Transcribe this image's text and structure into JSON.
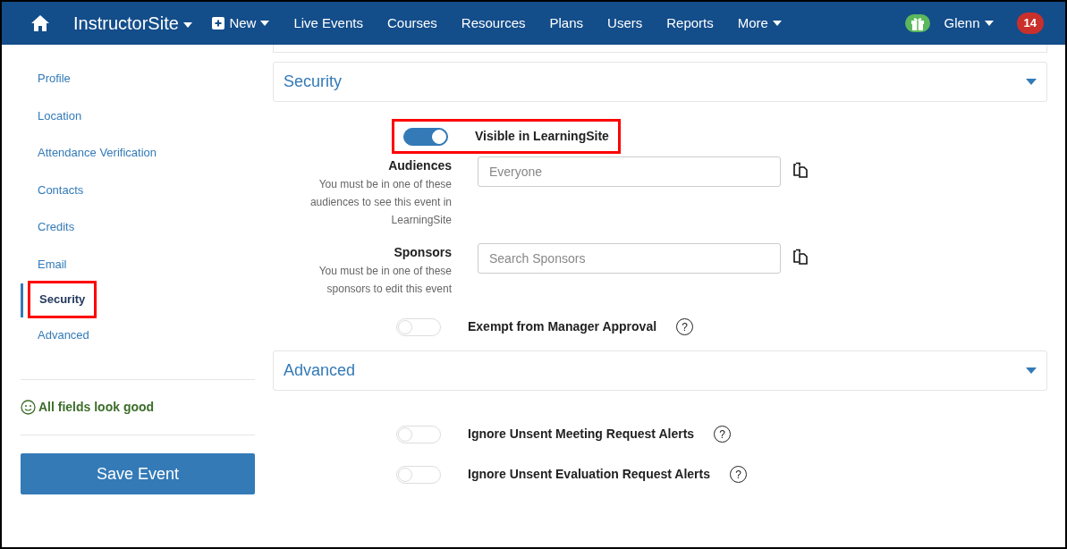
{
  "navbar": {
    "brand": "InstructorSite",
    "items": [
      {
        "label": "New",
        "kind": "new",
        "dropdown": true
      },
      {
        "label": "Live Events",
        "kind": "link",
        "dropdown": false
      },
      {
        "label": "Courses",
        "kind": "link",
        "dropdown": false
      },
      {
        "label": "Resources",
        "kind": "link",
        "dropdown": false
      },
      {
        "label": "Plans",
        "kind": "link",
        "dropdown": false
      },
      {
        "label": "Users",
        "kind": "link",
        "dropdown": false
      },
      {
        "label": "Reports",
        "kind": "link",
        "dropdown": false
      },
      {
        "label": "More",
        "kind": "link",
        "dropdown": true
      }
    ],
    "user": "Glenn",
    "notifications": "14"
  },
  "sidebar": {
    "items": [
      {
        "label": "Profile",
        "selected": false,
        "highlighted": false
      },
      {
        "label": "Location",
        "selected": false,
        "highlighted": false
      },
      {
        "label": "Attendance Verification",
        "selected": false,
        "highlighted": false
      },
      {
        "label": "Contacts",
        "selected": false,
        "highlighted": false
      },
      {
        "label": "Credits",
        "selected": false,
        "highlighted": false
      },
      {
        "label": "Email",
        "selected": false,
        "highlighted": false
      },
      {
        "label": "Security",
        "selected": true,
        "highlighted": true
      },
      {
        "label": "Advanced",
        "selected": false,
        "highlighted": false
      }
    ],
    "status": "All fields look good",
    "save_button": "Save Event"
  },
  "sections": [
    {
      "title": "Security",
      "rows": [
        {
          "kind": "toggle",
          "label": "Visible in LearningSite",
          "on": true,
          "highlighted": true
        },
        {
          "kind": "field",
          "label": "Audiences",
          "hint": "You must be in one of these audiences to see this event in LearningSite",
          "placeholder": "Everyone"
        },
        {
          "kind": "field",
          "label": "Sponsors",
          "hint": "You must be in one of these sponsors to edit this event",
          "placeholder": "Search Sponsors"
        },
        {
          "kind": "toggle",
          "label": "Exempt from Manager Approval",
          "on": false,
          "highlighted": false,
          "help": "?"
        }
      ]
    },
    {
      "title": "Advanced",
      "rows": [
        {
          "kind": "toggle",
          "label": "Ignore Unsent Meeting Request Alerts",
          "on": false,
          "highlighted": false,
          "help": "?"
        },
        {
          "kind": "toggle",
          "label": "Ignore Unsent Evaluation Request Alerts",
          "on": false,
          "highlighted": false,
          "help": "?"
        }
      ]
    }
  ]
}
